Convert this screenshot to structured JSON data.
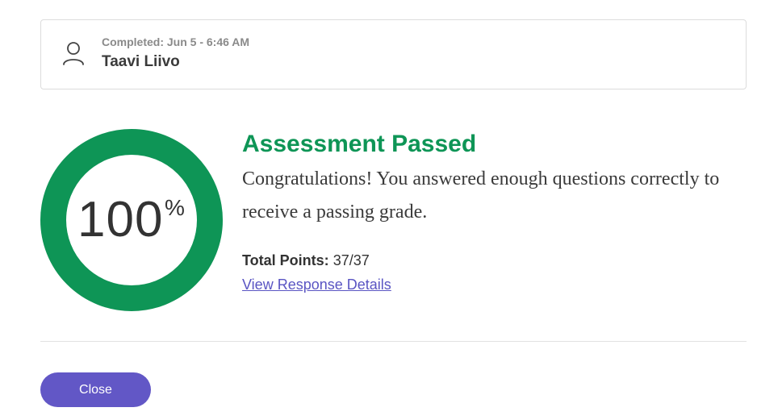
{
  "user_card": {
    "completed_text": "Completed: Jun 5 - 6:46 AM",
    "user_name": "Taavi Liivo",
    "icon": "user-icon"
  },
  "score": {
    "value": "100",
    "unit": "%",
    "percent": 100,
    "ring_color": "#0e9556"
  },
  "result": {
    "title": "Assessment Passed",
    "message": "Congratulations! You answered enough questions correctly to receive a passing grade.",
    "points_label": "Total Points:",
    "points_value": "37/37",
    "details_link": "View Response Details"
  },
  "actions": {
    "close_label": "Close"
  },
  "colors": {
    "success": "#0e9556",
    "accent": "#6257c6",
    "link": "#5a55c3"
  }
}
